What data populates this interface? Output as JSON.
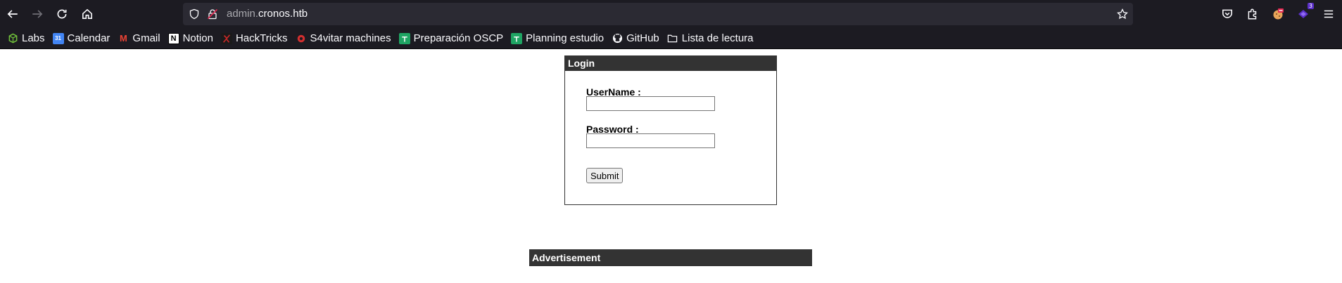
{
  "browser": {
    "url_prefix": "admin.",
    "url_domain": "cronos.htb",
    "extension_badge": "3"
  },
  "bookmarks": [
    {
      "label": "Labs",
      "icon": "cube-icon",
      "color": "#6fbf3a"
    },
    {
      "label": "Calendar",
      "icon": "calendar-icon",
      "color": "#4285f4",
      "glyph": "31"
    },
    {
      "label": "Gmail",
      "icon": "gmail-icon",
      "color": "#ea4335",
      "glyph": "M"
    },
    {
      "label": "Notion",
      "icon": "notion-icon",
      "color": "#ffffff",
      "glyph": "N"
    },
    {
      "label": "HackTricks",
      "icon": "hacktricks-icon",
      "color": "#c62828"
    },
    {
      "label": "S4vitar machines",
      "icon": "s4vitar-icon",
      "color": "#d32f2f"
    },
    {
      "label": "Preparación OSCP",
      "icon": "sheets-icon",
      "color": "#1fa463"
    },
    {
      "label": "Planning estudio",
      "icon": "sheets-icon",
      "color": "#1fa463"
    },
    {
      "label": "GitHub",
      "icon": "github-icon",
      "color": "#ffffff"
    },
    {
      "label": "Lista de lectura",
      "icon": "folder-icon",
      "color": "#fbfbfe"
    }
  ],
  "login": {
    "title": "Login",
    "username_label": "UserName :",
    "username_value": "",
    "password_label": "Password :",
    "password_value": "",
    "submit_label": "Submit"
  },
  "advertisement": {
    "title": "Advertisement"
  }
}
